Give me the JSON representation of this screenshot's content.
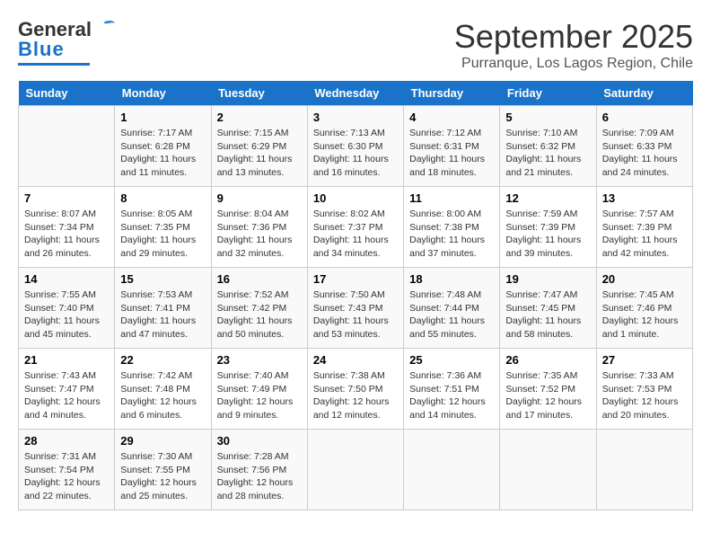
{
  "header": {
    "logo_general": "General",
    "logo_blue": "Blue",
    "month_title": "September 2025",
    "location": "Purranque, Los Lagos Region, Chile"
  },
  "calendar": {
    "days_of_week": [
      "Sunday",
      "Monday",
      "Tuesday",
      "Wednesday",
      "Thursday",
      "Friday",
      "Saturday"
    ],
    "weeks": [
      [
        {
          "day": "",
          "info": ""
        },
        {
          "day": "1",
          "info": "Sunrise: 7:17 AM\nSunset: 6:28 PM\nDaylight: 11 hours\nand 11 minutes."
        },
        {
          "day": "2",
          "info": "Sunrise: 7:15 AM\nSunset: 6:29 PM\nDaylight: 11 hours\nand 13 minutes."
        },
        {
          "day": "3",
          "info": "Sunrise: 7:13 AM\nSunset: 6:30 PM\nDaylight: 11 hours\nand 16 minutes."
        },
        {
          "day": "4",
          "info": "Sunrise: 7:12 AM\nSunset: 6:31 PM\nDaylight: 11 hours\nand 18 minutes."
        },
        {
          "day": "5",
          "info": "Sunrise: 7:10 AM\nSunset: 6:32 PM\nDaylight: 11 hours\nand 21 minutes."
        },
        {
          "day": "6",
          "info": "Sunrise: 7:09 AM\nSunset: 6:33 PM\nDaylight: 11 hours\nand 24 minutes."
        }
      ],
      [
        {
          "day": "7",
          "info": "Sunrise: 8:07 AM\nSunset: 7:34 PM\nDaylight: 11 hours\nand 26 minutes."
        },
        {
          "day": "8",
          "info": "Sunrise: 8:05 AM\nSunset: 7:35 PM\nDaylight: 11 hours\nand 29 minutes."
        },
        {
          "day": "9",
          "info": "Sunrise: 8:04 AM\nSunset: 7:36 PM\nDaylight: 11 hours\nand 32 minutes."
        },
        {
          "day": "10",
          "info": "Sunrise: 8:02 AM\nSunset: 7:37 PM\nDaylight: 11 hours\nand 34 minutes."
        },
        {
          "day": "11",
          "info": "Sunrise: 8:00 AM\nSunset: 7:38 PM\nDaylight: 11 hours\nand 37 minutes."
        },
        {
          "day": "12",
          "info": "Sunrise: 7:59 AM\nSunset: 7:39 PM\nDaylight: 11 hours\nand 39 minutes."
        },
        {
          "day": "13",
          "info": "Sunrise: 7:57 AM\nSunset: 7:39 PM\nDaylight: 11 hours\nand 42 minutes."
        }
      ],
      [
        {
          "day": "14",
          "info": "Sunrise: 7:55 AM\nSunset: 7:40 PM\nDaylight: 11 hours\nand 45 minutes."
        },
        {
          "day": "15",
          "info": "Sunrise: 7:53 AM\nSunset: 7:41 PM\nDaylight: 11 hours\nand 47 minutes."
        },
        {
          "day": "16",
          "info": "Sunrise: 7:52 AM\nSunset: 7:42 PM\nDaylight: 11 hours\nand 50 minutes."
        },
        {
          "day": "17",
          "info": "Sunrise: 7:50 AM\nSunset: 7:43 PM\nDaylight: 11 hours\nand 53 minutes."
        },
        {
          "day": "18",
          "info": "Sunrise: 7:48 AM\nSunset: 7:44 PM\nDaylight: 11 hours\nand 55 minutes."
        },
        {
          "day": "19",
          "info": "Sunrise: 7:47 AM\nSunset: 7:45 PM\nDaylight: 11 hours\nand 58 minutes."
        },
        {
          "day": "20",
          "info": "Sunrise: 7:45 AM\nSunset: 7:46 PM\nDaylight: 12 hours\nand 1 minute."
        }
      ],
      [
        {
          "day": "21",
          "info": "Sunrise: 7:43 AM\nSunset: 7:47 PM\nDaylight: 12 hours\nand 4 minutes."
        },
        {
          "day": "22",
          "info": "Sunrise: 7:42 AM\nSunset: 7:48 PM\nDaylight: 12 hours\nand 6 minutes."
        },
        {
          "day": "23",
          "info": "Sunrise: 7:40 AM\nSunset: 7:49 PM\nDaylight: 12 hours\nand 9 minutes."
        },
        {
          "day": "24",
          "info": "Sunrise: 7:38 AM\nSunset: 7:50 PM\nDaylight: 12 hours\nand 12 minutes."
        },
        {
          "day": "25",
          "info": "Sunrise: 7:36 AM\nSunset: 7:51 PM\nDaylight: 12 hours\nand 14 minutes."
        },
        {
          "day": "26",
          "info": "Sunrise: 7:35 AM\nSunset: 7:52 PM\nDaylight: 12 hours\nand 17 minutes."
        },
        {
          "day": "27",
          "info": "Sunrise: 7:33 AM\nSunset: 7:53 PM\nDaylight: 12 hours\nand 20 minutes."
        }
      ],
      [
        {
          "day": "28",
          "info": "Sunrise: 7:31 AM\nSunset: 7:54 PM\nDaylight: 12 hours\nand 22 minutes."
        },
        {
          "day": "29",
          "info": "Sunrise: 7:30 AM\nSunset: 7:55 PM\nDaylight: 12 hours\nand 25 minutes."
        },
        {
          "day": "30",
          "info": "Sunrise: 7:28 AM\nSunset: 7:56 PM\nDaylight: 12 hours\nand 28 minutes."
        },
        {
          "day": "",
          "info": ""
        },
        {
          "day": "",
          "info": ""
        },
        {
          "day": "",
          "info": ""
        },
        {
          "day": "",
          "info": ""
        }
      ]
    ]
  }
}
